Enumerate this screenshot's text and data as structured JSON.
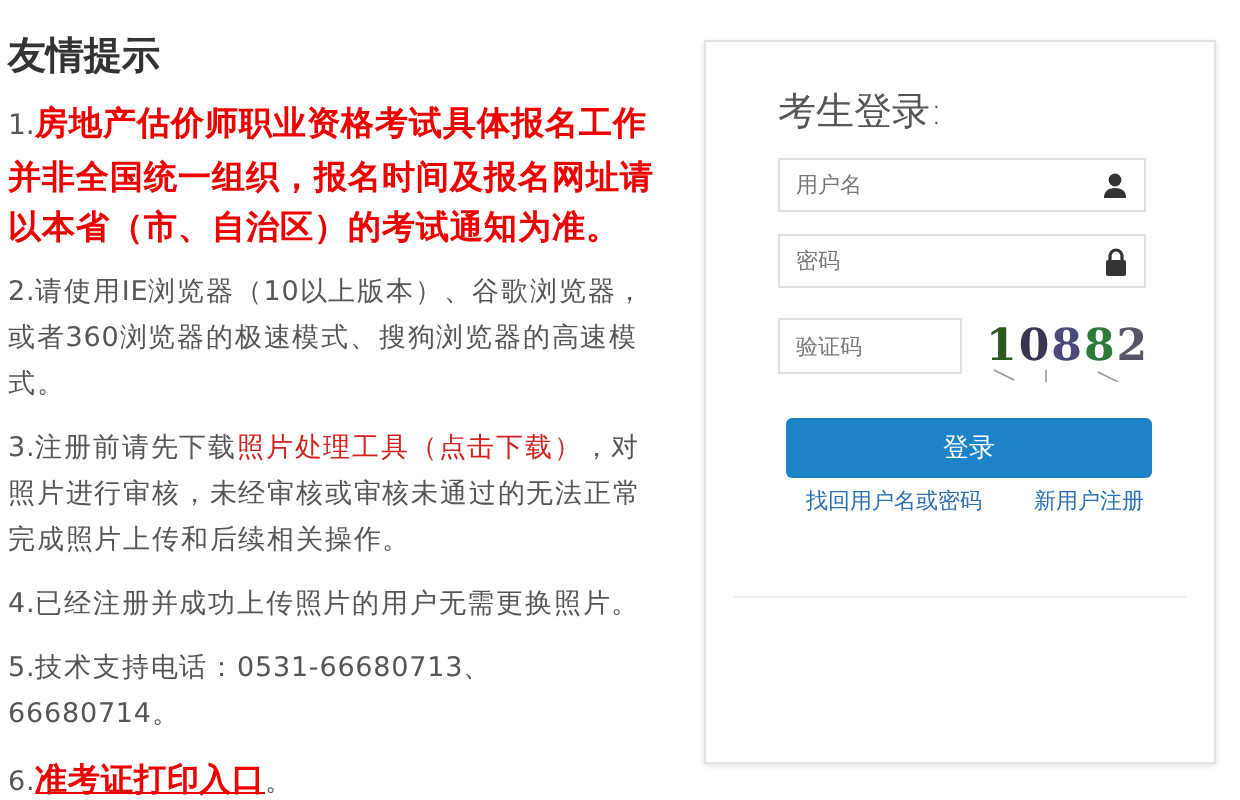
{
  "notice": {
    "title": "友情提示",
    "items": [
      {
        "parts": [
          {
            "kind": "plain",
            "text": "1."
          },
          {
            "kind": "emphasis",
            "text": "房地产估价师职业资格考试具体报名工作并非全国统一组织，报名时间及报名网址请以本省（市、自治区）的考试通知为准。"
          }
        ]
      },
      {
        "parts": [
          {
            "kind": "plain",
            "text": "2.请使用IE浏览器（10以上版本）、谷歌浏览器，或者360浏览器的极速模式、搜狗浏览器的高速模式。"
          }
        ]
      },
      {
        "parts": [
          {
            "kind": "plain",
            "text": "3.注册前请先下载"
          },
          {
            "kind": "link",
            "text": "照片处理工具（点击下载）"
          },
          {
            "kind": "plain",
            "text": "，对照片进行审核，未经审核或审核未通过的无法正常完成照片上传和后续相关操作。"
          }
        ]
      },
      {
        "parts": [
          {
            "kind": "plain",
            "text": "4.已经注册并成功上传照片的用户无需更换照片。"
          }
        ]
      },
      {
        "parts": [
          {
            "kind": "plain",
            "text": "5.技术支持电话：0531-66680713、66680714。"
          }
        ]
      },
      {
        "parts": [
          {
            "kind": "plain",
            "text": "6."
          },
          {
            "kind": "strong-link",
            "text": "准考证打印入口"
          },
          {
            "kind": "plain",
            "text": "。"
          }
        ]
      }
    ]
  },
  "login": {
    "title": "考生登录:",
    "username": {
      "placeholder": "用户名"
    },
    "password": {
      "placeholder": "密码"
    },
    "captcha_field": {
      "placeholder": "验证码"
    },
    "captcha": "10882",
    "button": "登录",
    "links": [
      "找回用户名或密码",
      "新用户注册"
    ]
  }
}
